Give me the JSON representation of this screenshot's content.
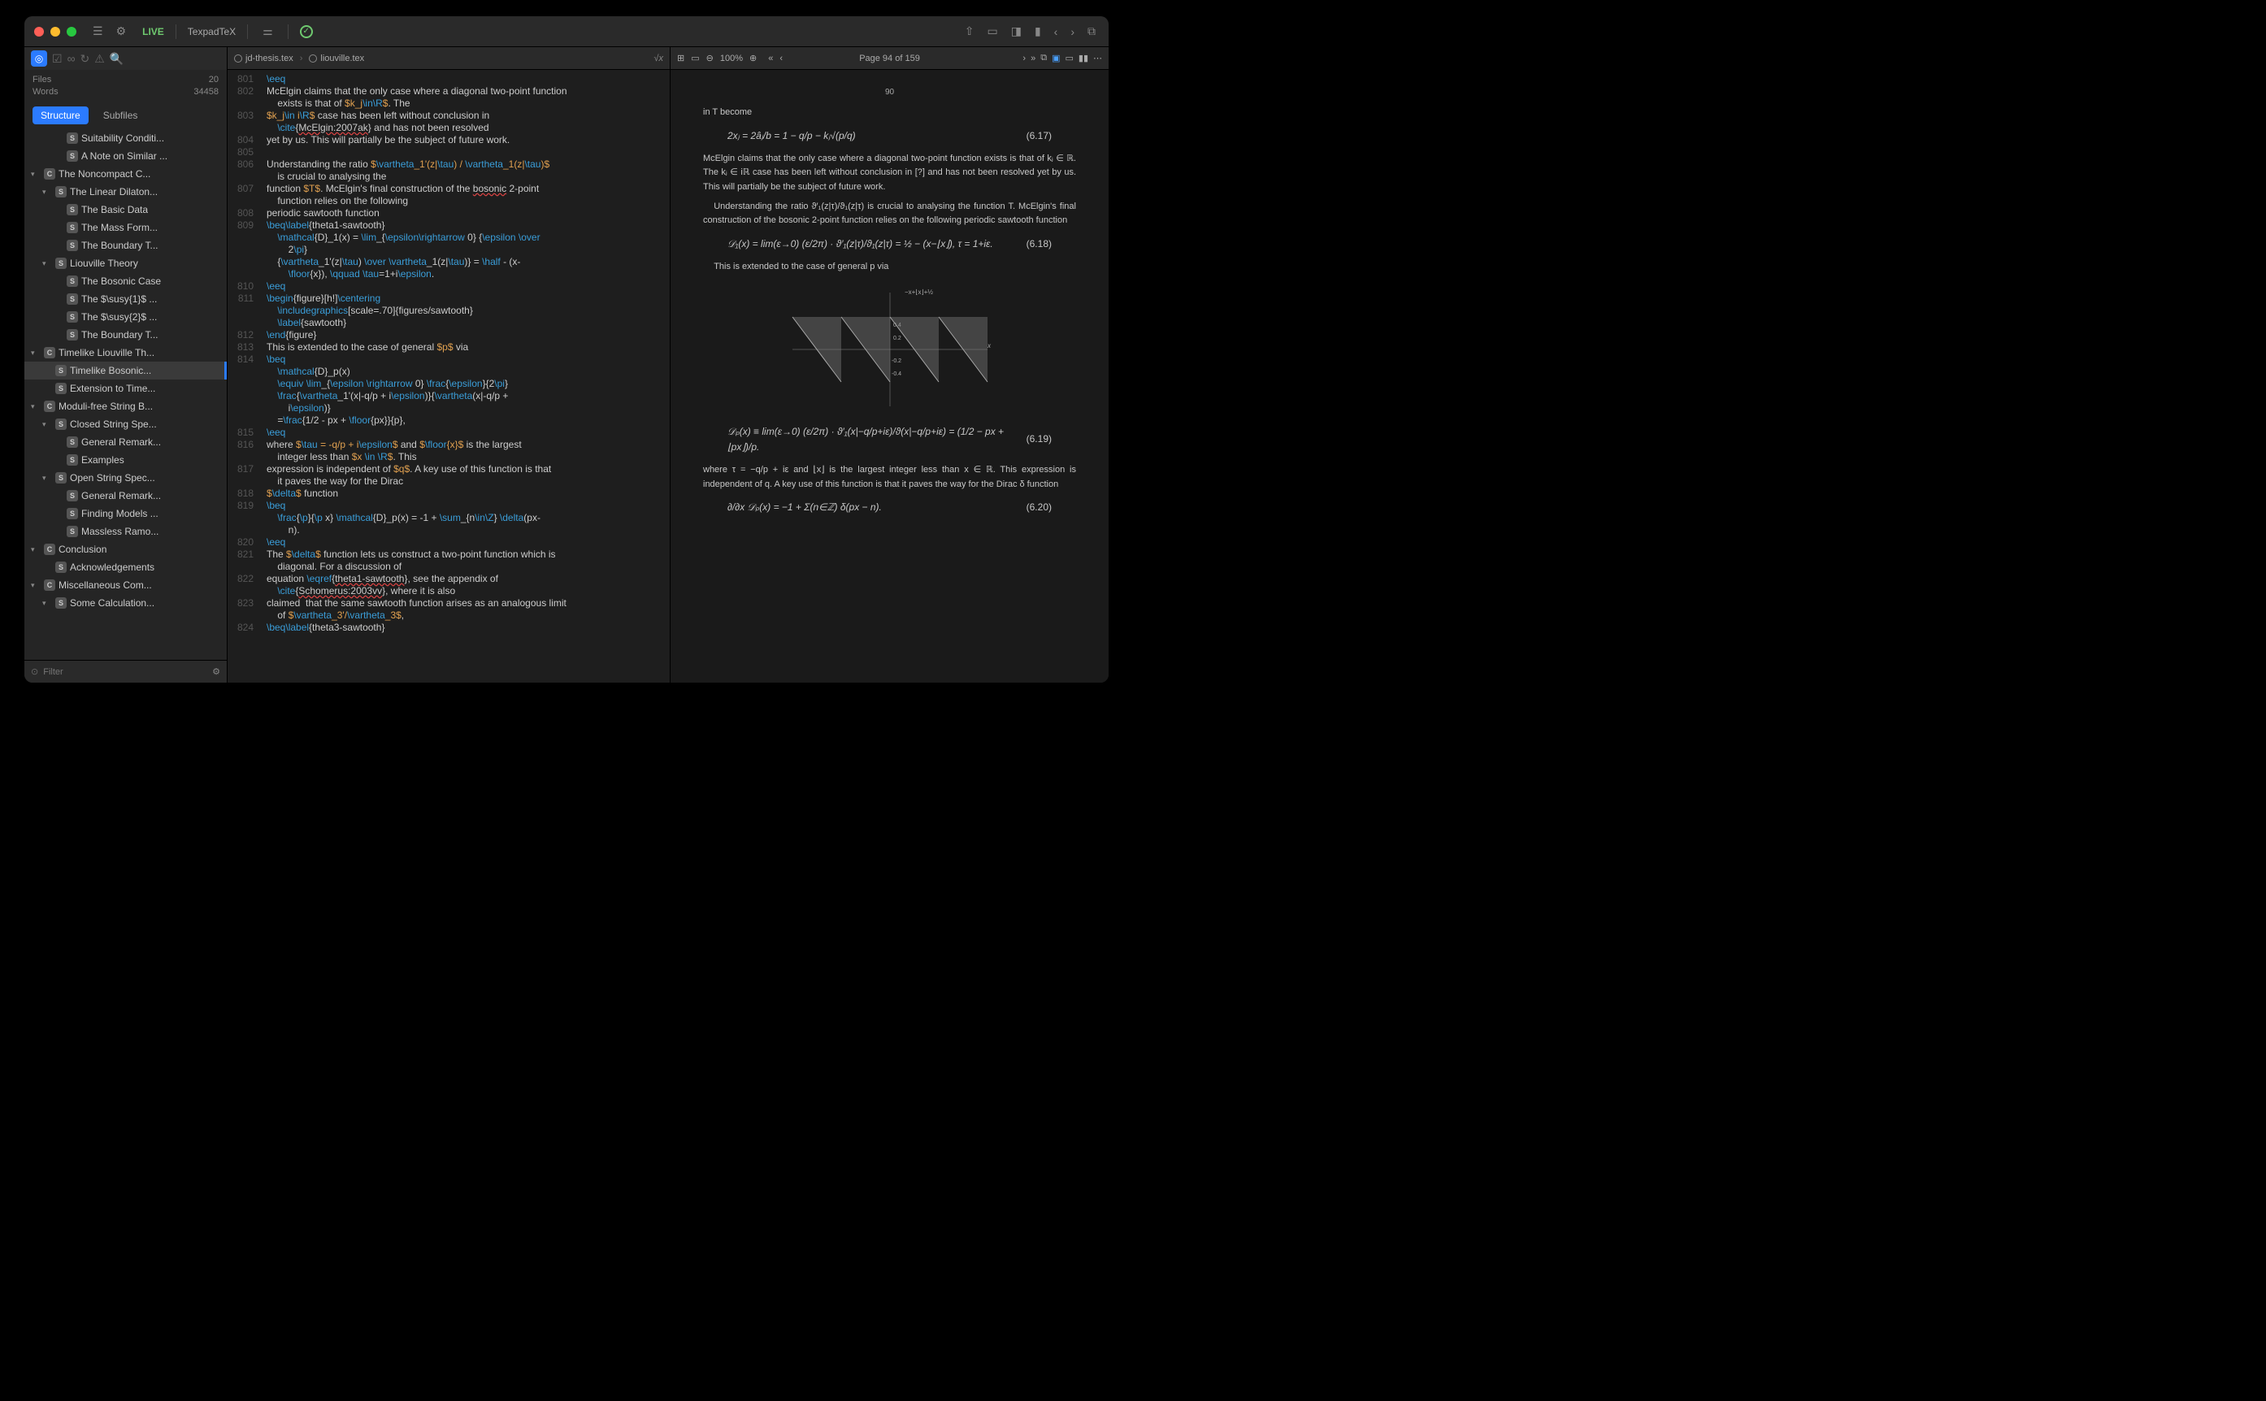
{
  "titlebar": {
    "live": "LIVE",
    "engine": "TexpadTeX"
  },
  "sidebar": {
    "files_label": "Files",
    "files_count": "20",
    "words_label": "Words",
    "words_count": "34458",
    "tabs": {
      "structure": "Structure",
      "subfiles": "Subfiles"
    },
    "filter_placeholder": "Filter",
    "tree": [
      {
        "d": 2,
        "b": "S",
        "l": "Suitability Conditi..."
      },
      {
        "d": 2,
        "b": "S",
        "l": "A Note on Similar ..."
      },
      {
        "d": 0,
        "b": "C",
        "l": "The Noncompact C...",
        "caret": "▾"
      },
      {
        "d": 1,
        "b": "S",
        "l": "The Linear Dilaton...",
        "caret": "▾"
      },
      {
        "d": 2,
        "b": "S",
        "l": "The Basic Data"
      },
      {
        "d": 2,
        "b": "S",
        "l": "The Mass Form..."
      },
      {
        "d": 2,
        "b": "S",
        "l": "The Boundary T..."
      },
      {
        "d": 1,
        "b": "S",
        "l": "Liouville Theory",
        "caret": "▾"
      },
      {
        "d": 2,
        "b": "S",
        "l": "The Bosonic Case"
      },
      {
        "d": 2,
        "b": "S",
        "l": "The $\\susy{1}$ ..."
      },
      {
        "d": 2,
        "b": "S",
        "l": "The $\\susy{2}$ ..."
      },
      {
        "d": 2,
        "b": "S",
        "l": "The Boundary T..."
      },
      {
        "d": 0,
        "b": "C",
        "l": "Timelike Liouville Th...",
        "caret": "▾"
      },
      {
        "d": 1,
        "b": "S",
        "l": "Timelike Bosonic...",
        "sel": true
      },
      {
        "d": 1,
        "b": "S",
        "l": "Extension to Time..."
      },
      {
        "d": 0,
        "b": "C",
        "l": "Moduli-free String B...",
        "caret": "▾"
      },
      {
        "d": 1,
        "b": "S",
        "l": "Closed String Spe...",
        "caret": "▾"
      },
      {
        "d": 2,
        "b": "S",
        "l": "General Remark..."
      },
      {
        "d": 2,
        "b": "S",
        "l": "Examples"
      },
      {
        "d": 1,
        "b": "S",
        "l": "Open String Spec...",
        "caret": "▾"
      },
      {
        "d": 2,
        "b": "S",
        "l": "General Remark..."
      },
      {
        "d": 2,
        "b": "S",
        "l": "Finding Models ..."
      },
      {
        "d": 2,
        "b": "S",
        "l": "Massless Ramo..."
      },
      {
        "d": 0,
        "b": "C",
        "l": "Conclusion",
        "caret": "▾"
      },
      {
        "d": 1,
        "b": "S",
        "l": "Acknowledgements"
      },
      {
        "d": 0,
        "b": "C",
        "l": "Miscellaneous Com...",
        "caret": "▾"
      },
      {
        "d": 1,
        "b": "S",
        "l": "Some Calculation...",
        "caret": "▾"
      }
    ]
  },
  "editor": {
    "tabs": {
      "root": "jd-thesis.tex",
      "file": "liouville.tex"
    },
    "sqrt": "√x",
    "first_line": 801,
    "lines": [
      "\\eeq",
      "McElgin claims that the only case where a diagonal two-point function",
      "    exists is that of $k_j\\in\\R$. The",
      "$k_j\\in i\\R$ case has been left without conclusion in",
      "    \\cite{McElgin:2007ak} and has not been resolved",
      "yet by us. This will partially be the subject of future work.",
      "",
      "Understanding the ratio $\\vartheta_1'(z|\\tau) / \\vartheta_1(z|\\tau)$",
      "    is crucial to analysing the",
      "function $T$. McElgin's final construction of the bosonic 2-point",
      "    function relies on the following",
      "periodic sawtooth function",
      "\\beq\\label{theta1-sawtooth}",
      "    \\mathcal{D}_1(x) = \\lim_{\\epsilon\\rightarrow 0} {\\epsilon \\over",
      "        2\\pi}",
      "    {\\vartheta_1'(z|\\tau) \\over \\vartheta_1(z|\\tau)} = \\half - (x-",
      "        \\floor{x}), \\qquad \\tau=1+i\\epsilon.",
      "\\eeq",
      "\\begin{figure}[h!]\\centering",
      "    \\includegraphics[scale=.70]{figures/sawtooth}",
      "    \\label{sawtooth}",
      "\\end{figure}",
      "This is extended to the case of general $p$ via",
      "\\beq",
      "    \\mathcal{D}_p(x)",
      "    \\equiv \\lim_{\\epsilon \\rightarrow 0} \\frac{\\epsilon}{2\\pi}",
      "    \\frac{\\vartheta_1'(x|-q/p + i\\epsilon)}{\\vartheta(x|-q/p +",
      "        i\\epsilon)}",
      "    =\\frac{1/2 - px + \\floor{px}}{p},",
      "\\eeq",
      "where $\\tau = -q/p + i\\epsilon$ and $\\floor{x}$ is the largest",
      "    integer less than $x \\in \\R$. This",
      "expression is independent of $q$. A key use of this function is that",
      "    it paves the way for the Dirac",
      "$\\delta$ function",
      "\\beq",
      "    \\frac{\\p}{\\p x} \\mathcal{D}_p(x) = -1 + \\sum_{n\\in\\Z} \\delta(px-",
      "        n).",
      "\\eeq",
      "The $\\delta$ function lets us construct a two-point function which is",
      "    diagonal. For a discussion of",
      "equation \\eqref{theta1-sawtooth}, see the appendix of",
      "    \\cite{Schomerus:2003vv}, where it is also",
      "claimed  that the same sawtooth function arises as an analogous limit",
      "    of $\\vartheta_3'/\\vartheta_3$,",
      "\\beq\\label{theta3-sawtooth}"
    ]
  },
  "preview": {
    "zoom": "100%",
    "page_label": "Page 94 of 159",
    "pagenum": "90",
    "intro": "in T become",
    "eq17": "2xⱼ = 2âⱼ/b = 1 − q/p − kⱼ√(p/q)",
    "eq17n": "(6.17)",
    "para1": "McElgin claims that the only case where a diagonal two-point function exists is that of kⱼ ∈ ℝ. The kⱼ ∈ iℝ case has been left without conclusion in [?] and has not been resolved yet by us. This will partially be the subject of future work.",
    "para2": "Understanding the ratio ϑ′₁(z|τ)/ϑ₁(z|τ) is crucial to analysing the function T. McElgin's final construction of the bosonic 2-point function relies on the following periodic sawtooth function",
    "eq18": "𝒟₁(x) = lim(ε→0) (ε/2π) · ϑ′₁(z|τ)/ϑ₁(z|τ) = ½ − (x−⌊x⌋),    τ = 1+iε.",
    "eq18n": "(6.18)",
    "para3": "This is extended to the case of general p via",
    "eq19": "𝒟ₚ(x) ≡ lim(ε→0) (ε/2π) · ϑ′₁(x|−q/p+iε)/ϑ(x|−q/p+iε) = (1/2 − px + ⌊px⌋)/p.",
    "eq19n": "(6.19)",
    "para4": "where τ = −q/p + iε and ⌊x⌋ is the largest integer less than x ∈ ℝ. This expression is independent of q. A key use of this function is that it paves the way for the Dirac δ function",
    "eq20": "∂/∂x 𝒟ₚ(x) = −1 + Σ(n∈ℤ) δ(px − n).",
    "eq20n": "(6.20)"
  }
}
